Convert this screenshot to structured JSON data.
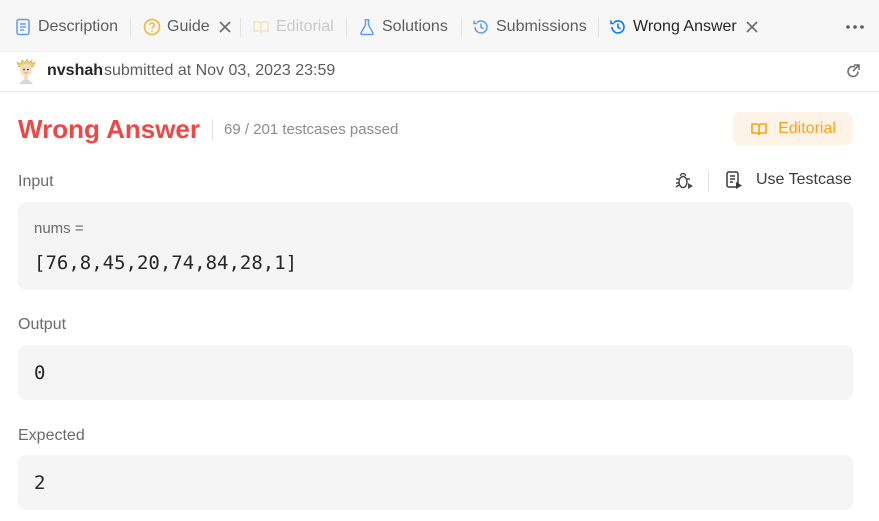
{
  "tabs": [
    {
      "label": "Description",
      "icon": "document-icon",
      "state": "normal"
    },
    {
      "label": "Guide",
      "icon": "question-circle-icon",
      "state": "normal",
      "closable": true
    },
    {
      "label": "Editorial",
      "icon": "book-icon",
      "state": "disabled"
    },
    {
      "label": "Solutions",
      "icon": "flask-icon",
      "state": "normal"
    },
    {
      "label": "Submissions",
      "icon": "history-icon",
      "state": "normal"
    },
    {
      "label": "Wrong Answer",
      "icon": "history-icon",
      "state": "active",
      "closable": true
    }
  ],
  "submission": {
    "username": "nvshah",
    "submitted_text": "submitted at Nov 03, 2023 23:59"
  },
  "result": {
    "verdict": "Wrong Answer",
    "passed": "69 / 201 testcases passed",
    "editorial_label": "Editorial"
  },
  "input": {
    "label": "Input",
    "var_name": "nums =",
    "value": "[76,8,45,20,74,84,28,1]",
    "use_testcase_label": "Use Testcase"
  },
  "output": {
    "label": "Output",
    "value": "0"
  },
  "expected": {
    "label": "Expected",
    "value": "2"
  },
  "colors": {
    "error": "#ef4743",
    "accent_blue": "#007bff",
    "editorial_orange": "#ffa116",
    "editorial_bg": "#fef3e7"
  }
}
